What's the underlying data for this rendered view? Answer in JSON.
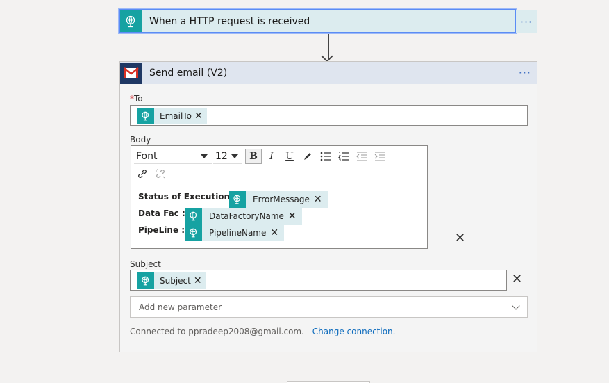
{
  "trigger": {
    "title": "When a HTTP request is received",
    "more": "···"
  },
  "action": {
    "title": "Send email (V2)",
    "more": "···",
    "to": {
      "required_mark": "*",
      "label": "To",
      "tokens": [
        "EmailTo"
      ]
    },
    "body": {
      "label": "Body",
      "toolbar": {
        "font": "Font",
        "size": "12",
        "bold": "B",
        "italic": "I",
        "underline": "U"
      },
      "lines": [
        {
          "label": "Status of Execution :",
          "token": "ErrorMessage"
        },
        {
          "label": "Data Fac   :",
          "token": "DataFactoryName"
        },
        {
          "label": "PipeLine   :",
          "token": "PipelineName"
        }
      ]
    },
    "subject": {
      "label": "Subject",
      "tokens": [
        "Subject"
      ]
    },
    "add_parameter_placeholder": "Add new parameter",
    "connected_text": "Connected to ppradeep2008@gmail.com.",
    "change_connection": "Change connection."
  },
  "colors": {
    "token_icon_bg": "#16a2a2",
    "token_bg": "#dcecef",
    "selected_border": "#5b8cf5",
    "link": "#0f6cbd",
    "header_bg": "#dfe5ef"
  },
  "icons": {
    "trigger": "http-request-icon",
    "action": "gmail-icon",
    "token": "http-request-icon",
    "remove": "close-icon"
  }
}
